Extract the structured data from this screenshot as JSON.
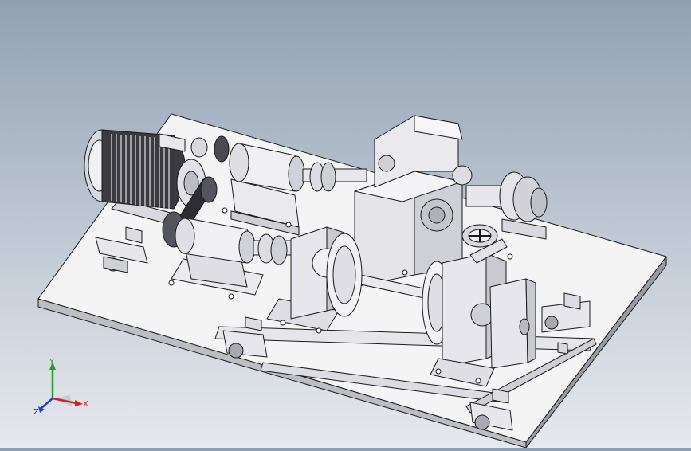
{
  "triad": {
    "x_label": "X",
    "y_label": "Y",
    "z_label": "Z",
    "x_color": "#d42020",
    "y_color": "#2a9a2a",
    "z_color": "#2040c8"
  },
  "colors": {
    "background_top": "#8fa0b3",
    "background_bottom": "#e6e9ee",
    "part_face": "#f2f2f2",
    "part_shade": "#c9c9ce",
    "part_dark": "#9a9aa3",
    "edge": "#1a1a1a"
  }
}
